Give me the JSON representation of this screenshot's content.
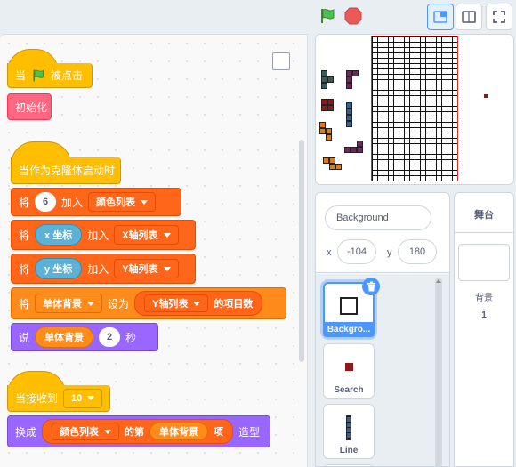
{
  "code": {
    "block1_hat_pre": "当",
    "block1_hat_post": "被点击",
    "block1_init": "初始化",
    "block2_hat": "当作为克隆体启动时",
    "r1_prefix": "将",
    "r1_value": "6",
    "r1_mid": "加入",
    "r1_list": "颜色列表",
    "r2_prefix": "将",
    "r2_reporter": "x 坐标",
    "r2_mid": "加入",
    "r2_list": "X轴列表",
    "r3_prefix": "将",
    "r3_reporter": "y 坐标",
    "r3_mid": "加入",
    "r3_list": "Y轴列表",
    "r4_prefix": "将",
    "r4_var": "单体背景",
    "r4_mid": "设为",
    "r4_list": "Y轴列表",
    "r4_suffix": "的项目数",
    "r5_prefix": "说",
    "r5_reporter": "单体背景",
    "r5_seconds": "2",
    "r5_suffix": "秒",
    "block3_hat_pre": "当接收到",
    "block3_msg": "10",
    "r6_prefix": "换成",
    "r6_list": "颜色列表",
    "r6_mid": "的第",
    "r6_var": "单体背景",
    "r6_item": "项",
    "r6_suffix": "造型"
  },
  "sprite_info": {
    "name": "Background",
    "x_label": "x",
    "x_value": "-104",
    "y_label": "y",
    "y_value": "180"
  },
  "sprites": [
    {
      "label": "Backgro..."
    },
    {
      "label": "Search"
    },
    {
      "label": "Line"
    }
  ],
  "stage_pane": {
    "title": "舞台",
    "backdrops_label": "背景",
    "backdrops_count": "1"
  },
  "colors": {
    "events": "#ffbf00",
    "variables": "#ff8c1a",
    "lists": "#ff661a",
    "looks": "#9966ff",
    "custom": "#ff6680",
    "motion": "#5cb1d6",
    "accent": "#4c97ff"
  }
}
